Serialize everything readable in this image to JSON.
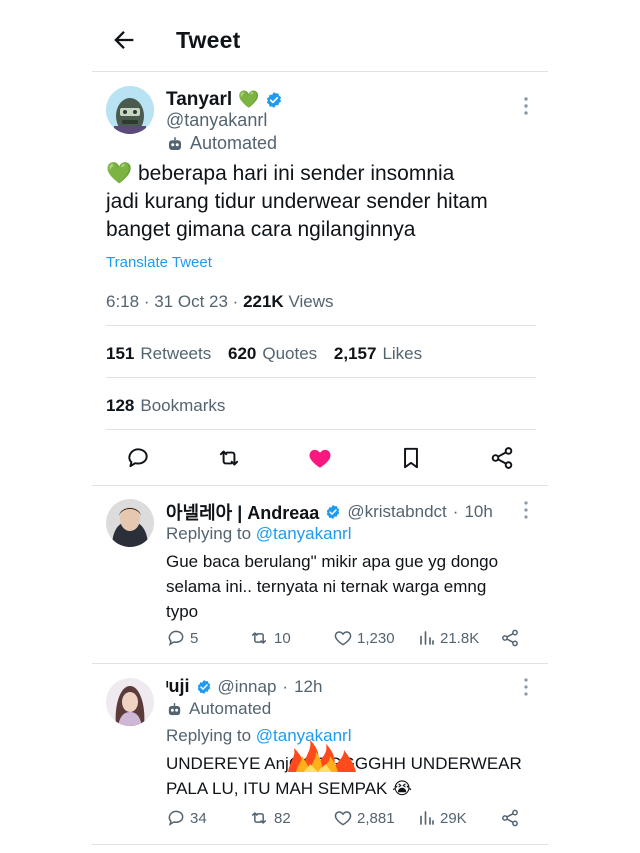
{
  "header": {
    "title": "Tweet"
  },
  "main_tweet": {
    "author_name": "Tanyarl",
    "name_emoji": "💚",
    "handle": "@tanyakanrl",
    "automated_label": "Automated",
    "text_emoji": "💚",
    "text_line1": "beberapa hari ini sender insomnia",
    "text_line2": "jadi kurang tidur underwear sender hitam",
    "text_line3": "banget gimana cara ngilanginnya",
    "translate_label": "Translate Tweet",
    "time": "6:18",
    "date": "31 Oct 23",
    "views_count": "221K",
    "views_label": "Views",
    "retweets_count": "151",
    "retweets_label": "Retweets",
    "quotes_count": "620",
    "quotes_label": "Quotes",
    "likes_count": "2,157",
    "likes_label": "Likes",
    "bookmarks_count": "128",
    "bookmarks_label": "Bookmarks",
    "like_color": "#f91880",
    "accent_color": "#1d9bf0"
  },
  "replies": [
    {
      "name": "아넬레아 | Andreaa",
      "handle": "@kristabndct",
      "time": "10h",
      "replying_prefix": "Replying to",
      "replying_to": "@tanyakanrl",
      "text_line1": "Gue baca berulang\" mikir apa gue yg dongo",
      "text_line2": "selama ini.. ternyata ni ternak warga emng",
      "text_line3": "typo",
      "replies_count": "5",
      "retweets_count": "10",
      "likes_count": "1,230",
      "views_count": "21.8K"
    },
    {
      "name": "ᶦuji",
      "handle": "@innap",
      "time": "12h",
      "automated_label": "Automated",
      "replying_prefix": "Replying to",
      "replying_to": "@tanyakanrl",
      "text_line1": "UNDEREYE AnjGGGGGGGHH UNDERWEAR",
      "text_line2": "PALA LU, ITU MAH SEMPAK 😭",
      "replies_count": "34",
      "retweets_count": "82",
      "likes_count": "2,881",
      "views_count": "29K"
    }
  ]
}
